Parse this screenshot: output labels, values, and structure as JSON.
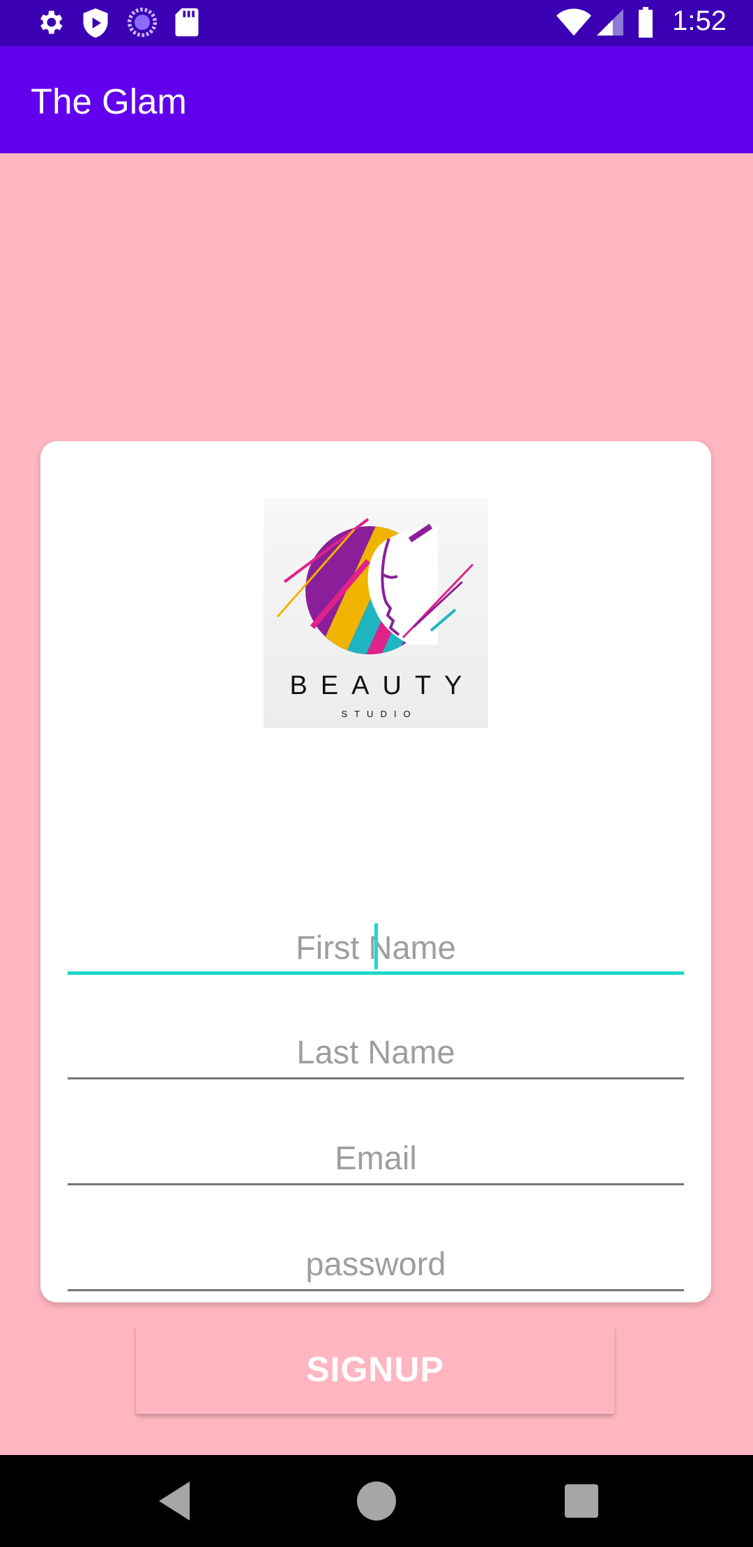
{
  "status_bar": {
    "time": "1:52",
    "left_icons": [
      "settings-icon",
      "play-protect-icon",
      "loading-icon",
      "sd-card-icon"
    ],
    "right_icons": [
      "wifi-icon",
      "signal-icon",
      "battery-icon"
    ]
  },
  "app_bar": {
    "title": "The Glam",
    "color": "#6200ee"
  },
  "logo": {
    "word": "BEAUTY",
    "subword": "STUDIO"
  },
  "form": {
    "first_name": {
      "placeholder": "First Name",
      "value": "",
      "focused": true
    },
    "last_name": {
      "placeholder": "Last Name",
      "value": ""
    },
    "email": {
      "placeholder": "Email",
      "value": ""
    },
    "password": {
      "placeholder": "password",
      "value": ""
    },
    "submit_label": "SIGNUP"
  },
  "colors": {
    "background": "#ffb6c1",
    "accent": "#1fd8c9",
    "status_bar": "#3b00b3"
  },
  "nav_bar": {
    "buttons": [
      "back-icon",
      "home-icon",
      "recents-icon"
    ]
  }
}
